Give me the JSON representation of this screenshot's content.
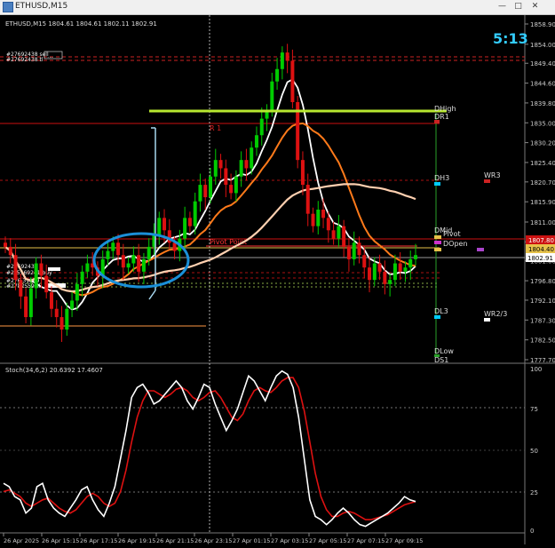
{
  "window": {
    "title": "ETHUSD,M15",
    "min_label": "—",
    "max_label": "□",
    "close_label": "✕"
  },
  "main": {
    "header": "ETHUSD,M15  1804.61 1804.61 1802.11 1802.91",
    "countdown": "5:13",
    "current_price": "1802.91"
  },
  "trade_lines": [
    "#27692438 sell",
    "#27692438 tl"
  ],
  "order_labels": [
    "#2​7692438 s",
    "#2_5569241 buy",
    "#2​76 31269",
    "#27​82559 sl"
  ],
  "levels": {
    "r1": "R 1",
    "pivot_point": "Pivot Point",
    "dhigh": "DHigh",
    "dr1": "DR1",
    "dh3": "DH3",
    "wr3": "WR3",
    "dmid": "DMid",
    "pivot": "Pivot",
    "dopen": "DOpen",
    "dl3": "DL3",
    "wr23": "WR2/3",
    "dlow": "DLow",
    "ds1": "DS1"
  },
  "price_axis": [
    "1858.90",
    "1854.00",
    "1849.40",
    "1844.60",
    "1839.80",
    "1835.00",
    "1830.20",
    "1825.40",
    "1820.70",
    "1815.90",
    "1811.00",
    "1806.20",
    "1801.60",
    "1796.80",
    "1792.10",
    "1787.30",
    "1782.50",
    "1777.70"
  ],
  "price_tags": [
    "1807.80",
    "1804.40",
    "1802.91"
  ],
  "indicator": {
    "label": "Stoch(34,6,2) 20.6392 17.4607",
    "axis": [
      "100",
      "75",
      "50",
      "25",
      "0"
    ]
  },
  "time_axis": [
    "26 Apr 2025",
    "26 Apr 15:15",
    "26 Apr 17:15",
    "26 Apr 19:15",
    "26 Apr 21:15",
    "26 Apr 23:15",
    "27 Apr 01:15",
    "27 Apr 03:15",
    "27 Apr 05:15",
    "27 Apr 07:15",
    "27 Apr 09:15"
  ],
  "colors": {
    "bull": "#00cc00",
    "bear": "#dd1111",
    "ma_white": "#ffffff",
    "ma_orange": "#ff7a1a",
    "ma_peach": "#ffd0b0",
    "highlight_line": "#b8e830",
    "ellipse": "#1a8fd8",
    "stoch_main": "#ffffff",
    "stoch_signal": "#dd1111",
    "countdown": "#33ccff"
  },
  "chart_data": {
    "type": "candlestick",
    "symbol": "ETHUSD",
    "timeframe": "M15",
    "ylim": [
      1777.7,
      1858.9
    ],
    "ohlc": [
      1804.61,
      1804.61,
      1802.11,
      1802.91
    ],
    "close_series": [
      1805,
      1803,
      1797,
      1793,
      1788,
      1795,
      1801,
      1798,
      1794,
      1790,
      1788,
      1785,
      1790,
      1792,
      1796,
      1799,
      1801,
      1800,
      1798,
      1802,
      1804,
      1806,
      1803,
      1800,
      1801,
      1803,
      1799,
      1802,
      1805,
      1808,
      1812,
      1809,
      1806,
      1804,
      1807,
      1812,
      1810,
      1816,
      1820,
      1817,
      1822,
      1826,
      1824,
      1820,
      1818,
      1822,
      1826,
      1824,
      1829,
      1832,
      1836,
      1838,
      1845,
      1848,
      1852,
      1850,
      1840,
      1826,
      1820,
      1813,
      1810,
      1814,
      1812,
      1809,
      1807,
      1810,
      1805,
      1802,
      1806,
      1803,
      1800,
      1797,
      1801,
      1799,
      1796,
      1797,
      1801,
      1799,
      1800,
      1802,
      1803
    ],
    "stoch_main": [
      30,
      28,
      22,
      20,
      12,
      15,
      28,
      30,
      20,
      15,
      12,
      10,
      15,
      20,
      26,
      28,
      20,
      14,
      10,
      18,
      28,
      45,
      62,
      82,
      88,
      90,
      85,
      78,
      80,
      84,
      88,
      92,
      88,
      80,
      75,
      82,
      90,
      88,
      78,
      70,
      62,
      68,
      75,
      85,
      95,
      92,
      86,
      80,
      88,
      95,
      98,
      96,
      88,
      70,
      45,
      20,
      10,
      8,
      5,
      8,
      12,
      15,
      12,
      8,
      5,
      4,
      6,
      8,
      10,
      12,
      15,
      18,
      22,
      20,
      19
    ],
    "stoch_signal": [
      25,
      26,
      24,
      22,
      18,
      16,
      18,
      20,
      21,
      18,
      15,
      13,
      12,
      14,
      18,
      22,
      24,
      22,
      18,
      16,
      18,
      25,
      38,
      55,
      70,
      80,
      86,
      86,
      84,
      82,
      84,
      87,
      88,
      86,
      82,
      80,
      82,
      85,
      86,
      82,
      76,
      70,
      68,
      72,
      80,
      86,
      88,
      86,
      85,
      88,
      92,
      94,
      94,
      88,
      74,
      55,
      36,
      22,
      14,
      10,
      10,
      12,
      13,
      12,
      10,
      8,
      8,
      9,
      10,
      11,
      13,
      15,
      17,
      18,
      19
    ]
  }
}
